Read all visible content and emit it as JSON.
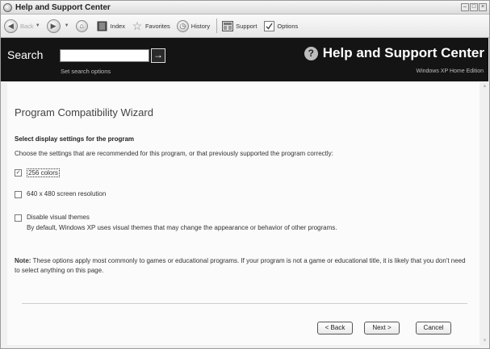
{
  "window": {
    "title": "Help and Support Center"
  },
  "toolbar": {
    "back_label": "Back",
    "index_label": "Index",
    "favorites_label": "Favorites",
    "history_label": "History",
    "support_label": "Support",
    "options_label": "Options"
  },
  "header": {
    "search_label": "Search",
    "search_value": "",
    "search_go_glyph": "→",
    "set_search_options": "Set search options",
    "title": "Help and Support Center",
    "edition": "Windows XP Home Edition"
  },
  "wizard": {
    "title": "Program Compatibility Wizard",
    "section_title": "Select display settings for the program",
    "instruction": "Choose the settings that are recommended for this program, or that previously supported the program correctly:",
    "options": [
      {
        "label": "256 colors",
        "checked": true
      },
      {
        "label": "640 x 480 screen resolution",
        "checked": false
      },
      {
        "label": "Disable visual themes",
        "checked": false
      }
    ],
    "themes_description": "By default, Windows XP uses visual themes that may change the appearance or behavior of other programs.",
    "note_label": "Note:",
    "note_text": " These options apply most commonly to games or educational programs. If your program is not a game or educational title, it is likely that you don't need to select anything on this page.",
    "buttons": {
      "back": "< Back",
      "next": "Next >",
      "cancel": "Cancel"
    }
  },
  "icons": {
    "app": "help-support-icon",
    "back": "back-arrow-icon",
    "forward": "forward-arrow-icon",
    "home": "home-icon",
    "index": "book-icon",
    "favorites": "star-icon",
    "history": "clock-icon",
    "support": "support-icon",
    "options": "options-checkbox-icon",
    "help": "question-mark-icon"
  }
}
